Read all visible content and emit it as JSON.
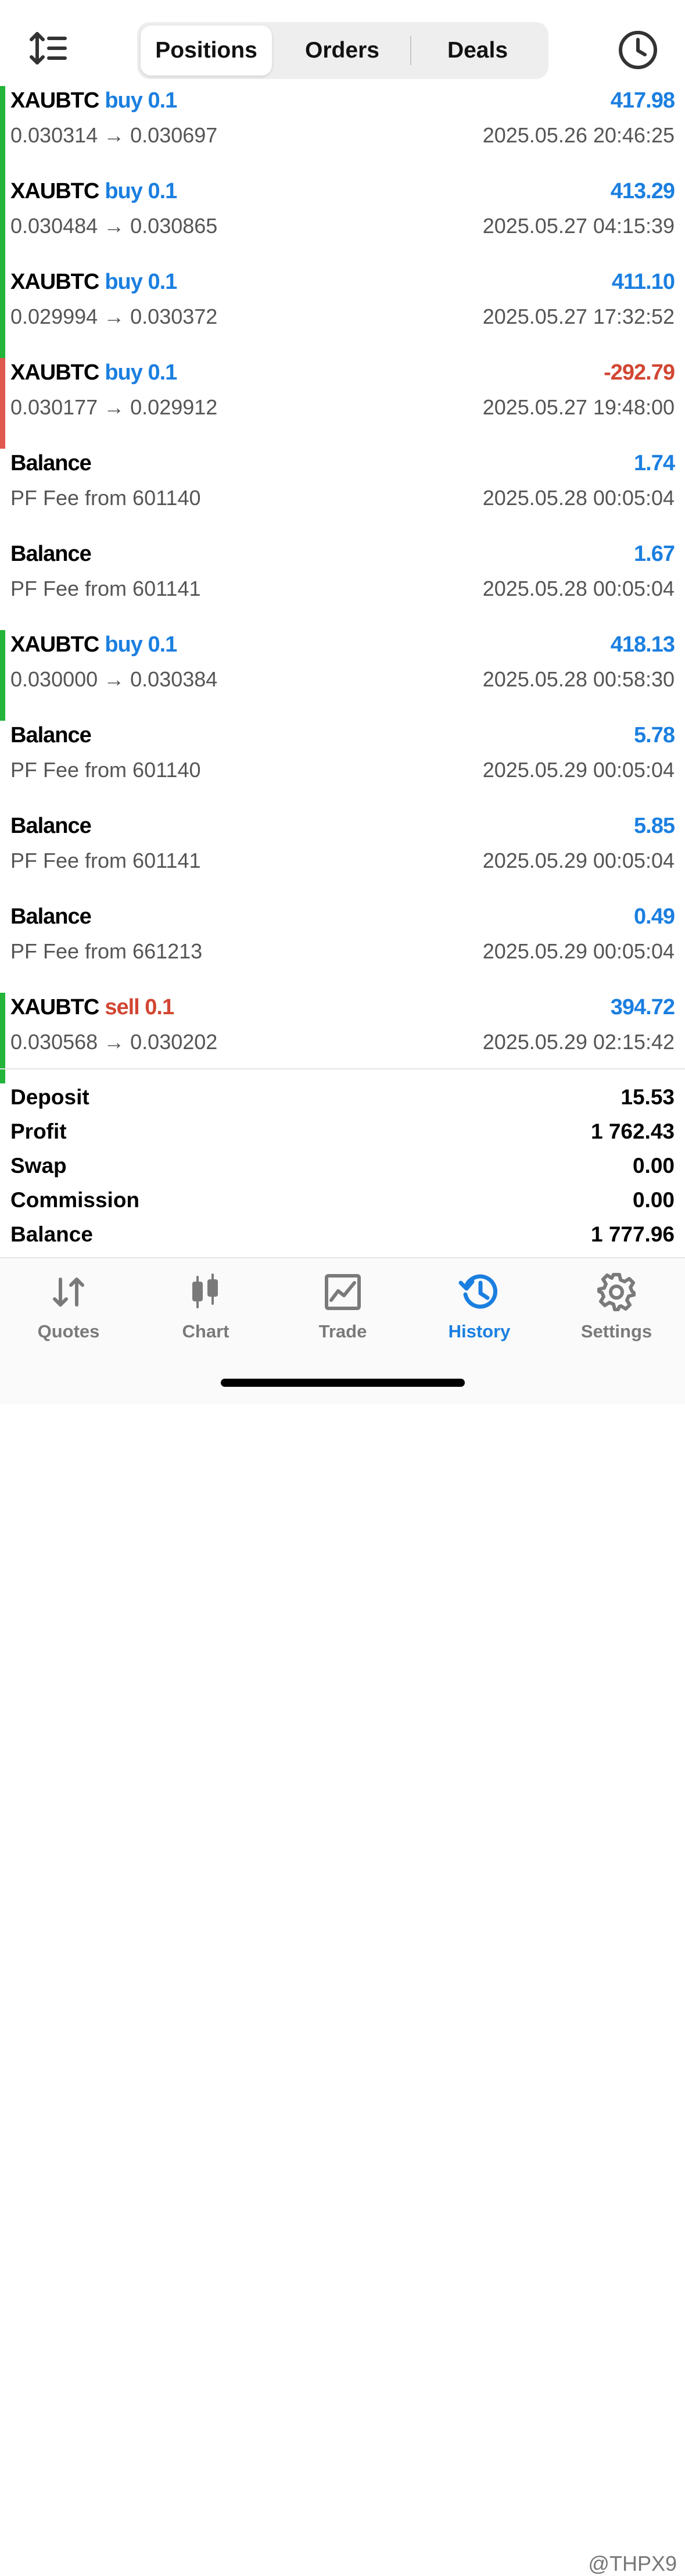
{
  "header": {
    "tabs": [
      "Positions",
      "Orders",
      "Deals"
    ],
    "icons": {
      "left": "sort-icon",
      "right": "clock-icon"
    }
  },
  "colors": {
    "accent": "#1b7fe0",
    "loss": "#d24633",
    "profit_bar": "#24b43a",
    "loss_bar": "#e0584f"
  },
  "rows": [
    {
      "kind": "trade",
      "symbol": "XAUBTC",
      "direction": "buy 0.1",
      "dir": "buy",
      "detail": "0.030314 → 0.030697",
      "time": "2025.05.26 20:46:25",
      "value": "417.98",
      "sign": "pos",
      "bar": "green"
    },
    {
      "kind": "trade",
      "symbol": "XAUBTC",
      "direction": "buy 0.1",
      "dir": "buy",
      "detail": "0.030484 → 0.030865",
      "time": "2025.05.27 04:15:39",
      "value": "413.29",
      "sign": "pos",
      "bar": "green"
    },
    {
      "kind": "trade",
      "symbol": "XAUBTC",
      "direction": "buy 0.1",
      "dir": "buy",
      "detail": "0.029994 → 0.030372",
      "time": "2025.05.27 17:32:52",
      "value": "411.10",
      "sign": "pos",
      "bar": "green"
    },
    {
      "kind": "trade",
      "symbol": "XAUBTC",
      "direction": "buy 0.1",
      "dir": "buy",
      "detail": "0.030177 → 0.029912",
      "time": "2025.05.27 19:48:00",
      "value": "-292.79",
      "sign": "neg",
      "bar": "red"
    },
    {
      "kind": "balance",
      "symbol": "Balance",
      "direction": "",
      "dir": "",
      "detail": "PF Fee from 601140",
      "time": "2025.05.28 00:05:04",
      "value": "1.74",
      "sign": "pos",
      "bar": "none"
    },
    {
      "kind": "balance",
      "symbol": "Balance",
      "direction": "",
      "dir": "",
      "detail": "PF Fee from 601141",
      "time": "2025.05.28 00:05:04",
      "value": "1.67",
      "sign": "pos",
      "bar": "none"
    },
    {
      "kind": "trade",
      "symbol": "XAUBTC",
      "direction": "buy 0.1",
      "dir": "buy",
      "detail": "0.030000 → 0.030384",
      "time": "2025.05.28 00:58:30",
      "value": "418.13",
      "sign": "pos",
      "bar": "green"
    },
    {
      "kind": "balance",
      "symbol": "Balance",
      "direction": "",
      "dir": "",
      "detail": "PF Fee from 601140",
      "time": "2025.05.29 00:05:04",
      "value": "5.78",
      "sign": "pos",
      "bar": "none"
    },
    {
      "kind": "balance",
      "symbol": "Balance",
      "direction": "",
      "dir": "",
      "detail": "PF Fee from 601141",
      "time": "2025.05.29 00:05:04",
      "value": "5.85",
      "sign": "pos",
      "bar": "none"
    },
    {
      "kind": "balance",
      "symbol": "Balance",
      "direction": "",
      "dir": "",
      "detail": "PF Fee from 661213",
      "time": "2025.05.29 00:05:04",
      "value": "0.49",
      "sign": "pos",
      "bar": "none"
    },
    {
      "kind": "trade",
      "symbol": "XAUBTC",
      "direction": "sell 0.1",
      "dir": "sell",
      "detail": "0.030568 → 0.030202",
      "time": "2025.05.29 02:15:42",
      "value": "394.72",
      "sign": "pos",
      "bar": "green"
    }
  ],
  "summary": [
    {
      "label": "Deposit",
      "value": "15.53"
    },
    {
      "label": "Profit",
      "value": "1 762.43"
    },
    {
      "label": "Swap",
      "value": "0.00"
    },
    {
      "label": "Commission",
      "value": "0.00"
    },
    {
      "label": "Balance",
      "value": "1 777.96"
    }
  ],
  "tabbar": [
    {
      "label": "Quotes",
      "icon": "quotes-icon",
      "active": false
    },
    {
      "label": "Chart",
      "icon": "chart-icon",
      "active": false
    },
    {
      "label": "Trade",
      "icon": "trade-icon",
      "active": false
    },
    {
      "label": "History",
      "icon": "history-icon",
      "active": true
    },
    {
      "label": "Settings",
      "icon": "settings-icon",
      "active": false
    }
  ],
  "watermark": "@THPX9"
}
